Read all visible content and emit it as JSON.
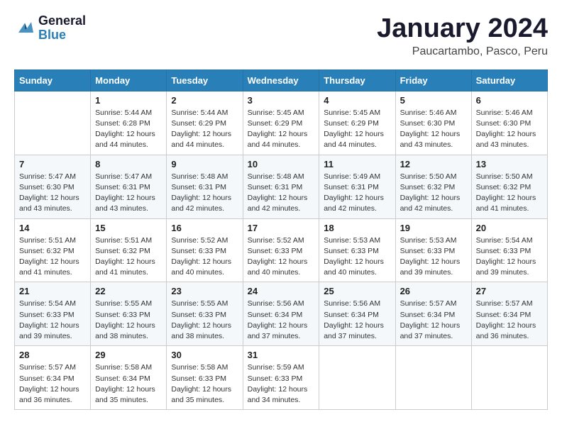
{
  "logo": {
    "line1": "General",
    "line2": "Blue"
  },
  "title": "January 2024",
  "subtitle": "Paucartambo, Pasco, Peru",
  "days_of_week": [
    "Sunday",
    "Monday",
    "Tuesday",
    "Wednesday",
    "Thursday",
    "Friday",
    "Saturday"
  ],
  "weeks": [
    [
      {
        "day": "",
        "info": ""
      },
      {
        "day": "1",
        "info": "Sunrise: 5:44 AM\nSunset: 6:28 PM\nDaylight: 12 hours\nand 44 minutes."
      },
      {
        "day": "2",
        "info": "Sunrise: 5:44 AM\nSunset: 6:29 PM\nDaylight: 12 hours\nand 44 minutes."
      },
      {
        "day": "3",
        "info": "Sunrise: 5:45 AM\nSunset: 6:29 PM\nDaylight: 12 hours\nand 44 minutes."
      },
      {
        "day": "4",
        "info": "Sunrise: 5:45 AM\nSunset: 6:29 PM\nDaylight: 12 hours\nand 44 minutes."
      },
      {
        "day": "5",
        "info": "Sunrise: 5:46 AM\nSunset: 6:30 PM\nDaylight: 12 hours\nand 43 minutes."
      },
      {
        "day": "6",
        "info": "Sunrise: 5:46 AM\nSunset: 6:30 PM\nDaylight: 12 hours\nand 43 minutes."
      }
    ],
    [
      {
        "day": "7",
        "info": "Sunrise: 5:47 AM\nSunset: 6:30 PM\nDaylight: 12 hours\nand 43 minutes."
      },
      {
        "day": "8",
        "info": "Sunrise: 5:47 AM\nSunset: 6:31 PM\nDaylight: 12 hours\nand 43 minutes."
      },
      {
        "day": "9",
        "info": "Sunrise: 5:48 AM\nSunset: 6:31 PM\nDaylight: 12 hours\nand 42 minutes."
      },
      {
        "day": "10",
        "info": "Sunrise: 5:48 AM\nSunset: 6:31 PM\nDaylight: 12 hours\nand 42 minutes."
      },
      {
        "day": "11",
        "info": "Sunrise: 5:49 AM\nSunset: 6:31 PM\nDaylight: 12 hours\nand 42 minutes."
      },
      {
        "day": "12",
        "info": "Sunrise: 5:50 AM\nSunset: 6:32 PM\nDaylight: 12 hours\nand 42 minutes."
      },
      {
        "day": "13",
        "info": "Sunrise: 5:50 AM\nSunset: 6:32 PM\nDaylight: 12 hours\nand 41 minutes."
      }
    ],
    [
      {
        "day": "14",
        "info": "Sunrise: 5:51 AM\nSunset: 6:32 PM\nDaylight: 12 hours\nand 41 minutes."
      },
      {
        "day": "15",
        "info": "Sunrise: 5:51 AM\nSunset: 6:32 PM\nDaylight: 12 hours\nand 41 minutes."
      },
      {
        "day": "16",
        "info": "Sunrise: 5:52 AM\nSunset: 6:33 PM\nDaylight: 12 hours\nand 40 minutes."
      },
      {
        "day": "17",
        "info": "Sunrise: 5:52 AM\nSunset: 6:33 PM\nDaylight: 12 hours\nand 40 minutes."
      },
      {
        "day": "18",
        "info": "Sunrise: 5:53 AM\nSunset: 6:33 PM\nDaylight: 12 hours\nand 40 minutes."
      },
      {
        "day": "19",
        "info": "Sunrise: 5:53 AM\nSunset: 6:33 PM\nDaylight: 12 hours\nand 39 minutes."
      },
      {
        "day": "20",
        "info": "Sunrise: 5:54 AM\nSunset: 6:33 PM\nDaylight: 12 hours\nand 39 minutes."
      }
    ],
    [
      {
        "day": "21",
        "info": "Sunrise: 5:54 AM\nSunset: 6:33 PM\nDaylight: 12 hours\nand 39 minutes."
      },
      {
        "day": "22",
        "info": "Sunrise: 5:55 AM\nSunset: 6:33 PM\nDaylight: 12 hours\nand 38 minutes."
      },
      {
        "day": "23",
        "info": "Sunrise: 5:55 AM\nSunset: 6:33 PM\nDaylight: 12 hours\nand 38 minutes."
      },
      {
        "day": "24",
        "info": "Sunrise: 5:56 AM\nSunset: 6:34 PM\nDaylight: 12 hours\nand 37 minutes."
      },
      {
        "day": "25",
        "info": "Sunrise: 5:56 AM\nSunset: 6:34 PM\nDaylight: 12 hours\nand 37 minutes."
      },
      {
        "day": "26",
        "info": "Sunrise: 5:57 AM\nSunset: 6:34 PM\nDaylight: 12 hours\nand 37 minutes."
      },
      {
        "day": "27",
        "info": "Sunrise: 5:57 AM\nSunset: 6:34 PM\nDaylight: 12 hours\nand 36 minutes."
      }
    ],
    [
      {
        "day": "28",
        "info": "Sunrise: 5:57 AM\nSunset: 6:34 PM\nDaylight: 12 hours\nand 36 minutes."
      },
      {
        "day": "29",
        "info": "Sunrise: 5:58 AM\nSunset: 6:34 PM\nDaylight: 12 hours\nand 35 minutes."
      },
      {
        "day": "30",
        "info": "Sunrise: 5:58 AM\nSunset: 6:33 PM\nDaylight: 12 hours\nand 35 minutes."
      },
      {
        "day": "31",
        "info": "Sunrise: 5:59 AM\nSunset: 6:33 PM\nDaylight: 12 hours\nand 34 minutes."
      },
      {
        "day": "",
        "info": ""
      },
      {
        "day": "",
        "info": ""
      },
      {
        "day": "",
        "info": ""
      }
    ]
  ]
}
